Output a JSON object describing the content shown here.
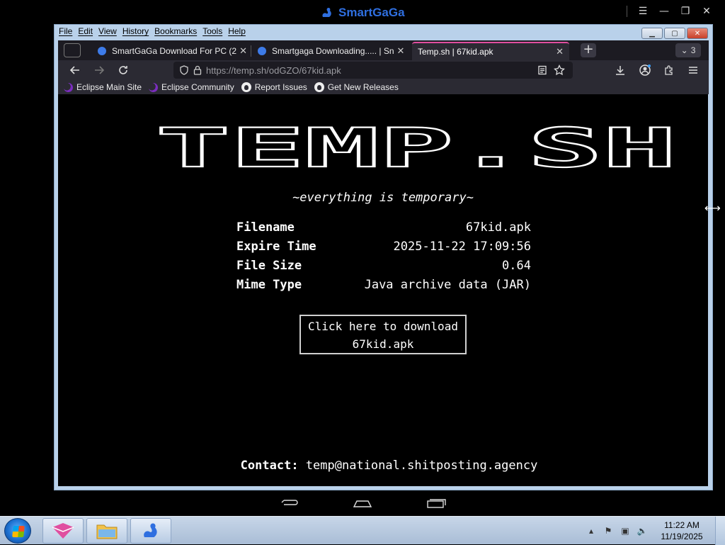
{
  "emulator": {
    "brand": "SmartGaGa"
  },
  "browser": {
    "menu": [
      "File",
      "Edit",
      "View",
      "History",
      "Bookmarks",
      "Tools",
      "Help"
    ],
    "tabs": [
      {
        "title": "SmartGaGa Download For PC (2"
      },
      {
        "title": "Smartgaga Downloading..... | Sn"
      },
      {
        "title": "Temp.sh | 67kid.apk"
      }
    ],
    "tab_count": "3",
    "url_host": "https://temp.sh",
    "url_path": "/odGZO/67kid.apk",
    "bookmarks": [
      {
        "label": "Eclipse Main Site",
        "icon": "eclipse-icon"
      },
      {
        "label": "Eclipse Community",
        "icon": "eclipse-icon"
      },
      {
        "label": "Report Issues",
        "icon": "github-icon"
      },
      {
        "label": "Get New Releases",
        "icon": "github-icon"
      }
    ]
  },
  "page": {
    "logo_text": "TEMP.SH",
    "tagline": "~everything is temporary~",
    "info": [
      {
        "key": "Filename",
        "value": "67kid.apk"
      },
      {
        "key": "Expire Time",
        "value": "2025-11-22 17:09:56"
      },
      {
        "key": "File Size",
        "value": "0.64"
      },
      {
        "key": "Mime Type",
        "value": "Java archive data (JAR)"
      }
    ],
    "download_line1": "Click here to download",
    "download_line2": "67kid.apk",
    "contact_label": "Contact:",
    "contact_email": "temp@national.shitposting.agency"
  },
  "taskbar": {
    "time": "11:22 AM",
    "date": "11/19/2025"
  },
  "colors": {
    "accent_tab": "#e04fa0",
    "brand_blue": "#2f6fe0",
    "page_bg": "#000000"
  }
}
